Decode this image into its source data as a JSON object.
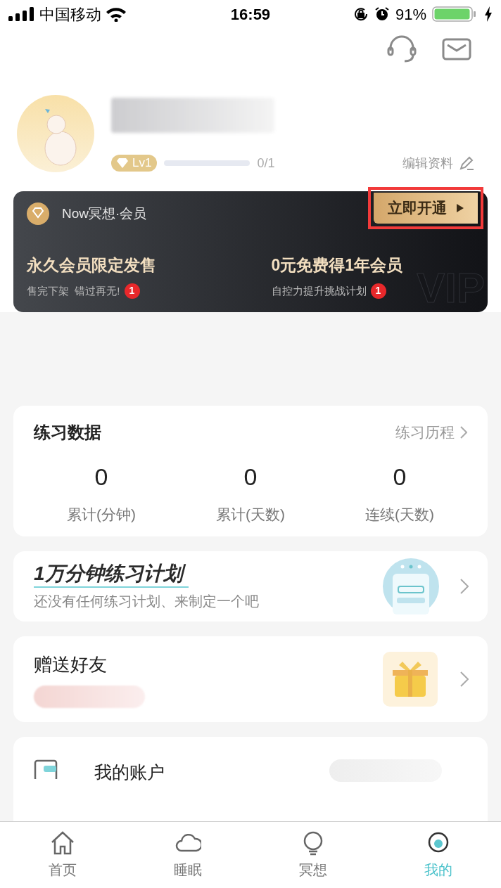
{
  "status_bar": {
    "carrier": "中国移动",
    "time": "16:59",
    "battery": "91%"
  },
  "profile": {
    "level_badge": "Lv1",
    "progress": {
      "level": 0
    },
    "progress_text": "0/1",
    "edit_label": "编辑资料"
  },
  "vip_card": {
    "title": "Now冥想·会员",
    "button": "立即开通",
    "highlighted": true,
    "watermark": "VIP",
    "offers": [
      {
        "title": "永久会员限定发售",
        "subtitle": "售完下架  错过再无!",
        "badge": "1"
      },
      {
        "title": "0元免费得1年会员",
        "subtitle": "自控力提升挑战计划",
        "badge": "1"
      }
    ]
  },
  "practice": {
    "title": "练习数据",
    "link": "练习历程",
    "stats": [
      {
        "value": "0",
        "label": "累计(分钟)"
      },
      {
        "value": "0",
        "label": "累计(天数)"
      },
      {
        "value": "0",
        "label": "连续(天数)"
      }
    ]
  },
  "plan": {
    "title": "**1万分钟**练习计划",
    "subtitle": "还没有任何练习计划、来制定一个吧"
  },
  "gift": {
    "title": "赠送好友"
  },
  "account": {
    "title": "我的账户"
  },
  "tabs": [
    {
      "label": "首页",
      "kind": "home",
      "selected": false
    },
    {
      "label": "睡眠",
      "kind": "cloud",
      "selected": false
    },
    {
      "label": "冥想",
      "kind": "bulb",
      "selected": false
    },
    {
      "label": "我的",
      "kind": "me",
      "selected": true
    }
  ]
}
